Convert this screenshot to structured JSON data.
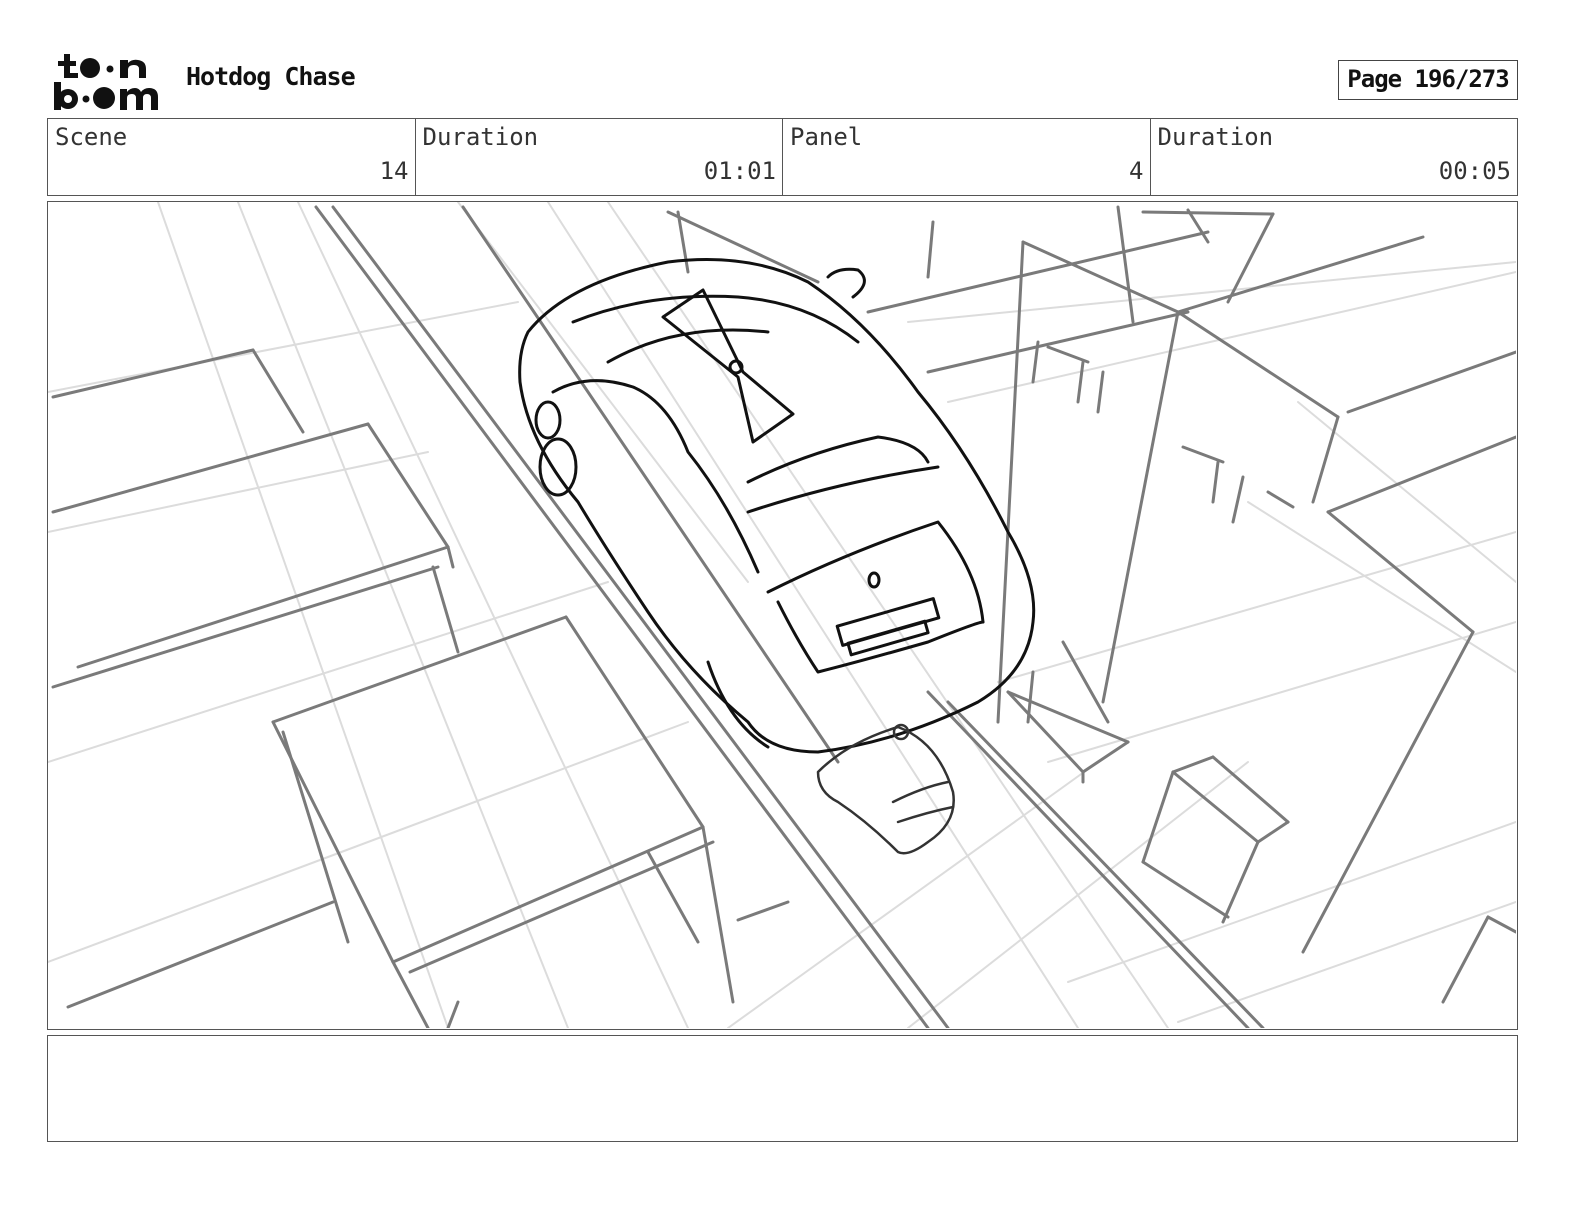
{
  "header": {
    "logo_text": "toon boom",
    "project_title": "Hotdog Chase",
    "page_label": "Page 196/273"
  },
  "info": [
    {
      "label": "Scene",
      "value": "14"
    },
    {
      "label": "Duration",
      "value": "01:01"
    },
    {
      "label": "Panel",
      "value": "4"
    },
    {
      "label": "Duration",
      "value": "00:05"
    }
  ],
  "panel": {
    "sketch_subject": "aerial-view-car-chase-sketch"
  },
  "notes": {
    "text": ""
  }
}
